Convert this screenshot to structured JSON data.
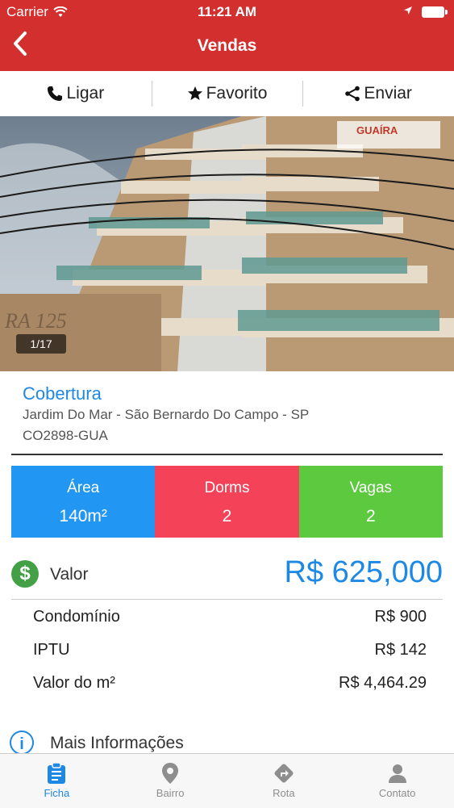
{
  "status": {
    "carrier": "Carrier",
    "time": "11:21 AM"
  },
  "nav": {
    "title": "Vendas"
  },
  "actions": [
    {
      "label": "Ligar",
      "icon": "phone-icon"
    },
    {
      "label": "Favorito",
      "icon": "star-icon"
    },
    {
      "label": "Enviar",
      "icon": "share-icon"
    }
  ],
  "photo": {
    "counter": "1/17",
    "watermark": "GUAÍRA",
    "facade_text": "RA 125"
  },
  "property": {
    "type": "Cobertura",
    "location": "Jardim Do Mar - São Bernardo Do Campo - SP",
    "code": "CO2898-GUA"
  },
  "stats": [
    {
      "label": "Área",
      "value": "140m²",
      "color": "#2196f3"
    },
    {
      "label": "Dorms",
      "value": "2",
      "color": "#f44358"
    },
    {
      "label": "Vagas",
      "value": "2",
      "color": "#5cc93f"
    }
  ],
  "valor": {
    "label": "Valor",
    "price": "R$ 625,000"
  },
  "costs": [
    {
      "label": "Condomínio",
      "value": "R$ 900"
    },
    {
      "label": "IPTU",
      "value": "R$ 142"
    },
    {
      "label": "Valor do m²",
      "value": "R$ 4,464.29"
    }
  ],
  "more": {
    "label": "Mais Informações"
  },
  "tabs": [
    {
      "label": "Ficha",
      "icon": "clipboard-icon",
      "active": true
    },
    {
      "label": "Bairro",
      "icon": "map-pin-icon",
      "active": false
    },
    {
      "label": "Rota",
      "icon": "route-icon",
      "active": false
    },
    {
      "label": "Contato",
      "icon": "person-icon",
      "active": false
    }
  ],
  "colors": {
    "header": "#d32f2f",
    "accent": "#1e88e5",
    "money": "#43a047"
  }
}
